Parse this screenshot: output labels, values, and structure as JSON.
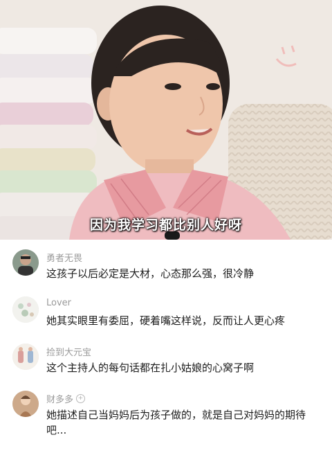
{
  "video": {
    "subtitle": "因为我学习都比别人好呀"
  },
  "comments": [
    {
      "username": "勇者无畏",
      "text": "这孩子以后必定是大材，心态那么强，很冷静",
      "badge": ""
    },
    {
      "username": "Lover",
      "text": "她其实眼里有委屈，硬着嘴这样说，反而让人更心疼",
      "badge": ""
    },
    {
      "username": "捡到大元宝",
      "text": "这个主持人的每句话都在扎小姑娘的心窝子啊",
      "badge": ""
    },
    {
      "username": "财多多",
      "text": "她描述自己当妈妈后为孩子做的，就是自己对妈妈的期待吧...",
      "badge": "+"
    }
  ]
}
